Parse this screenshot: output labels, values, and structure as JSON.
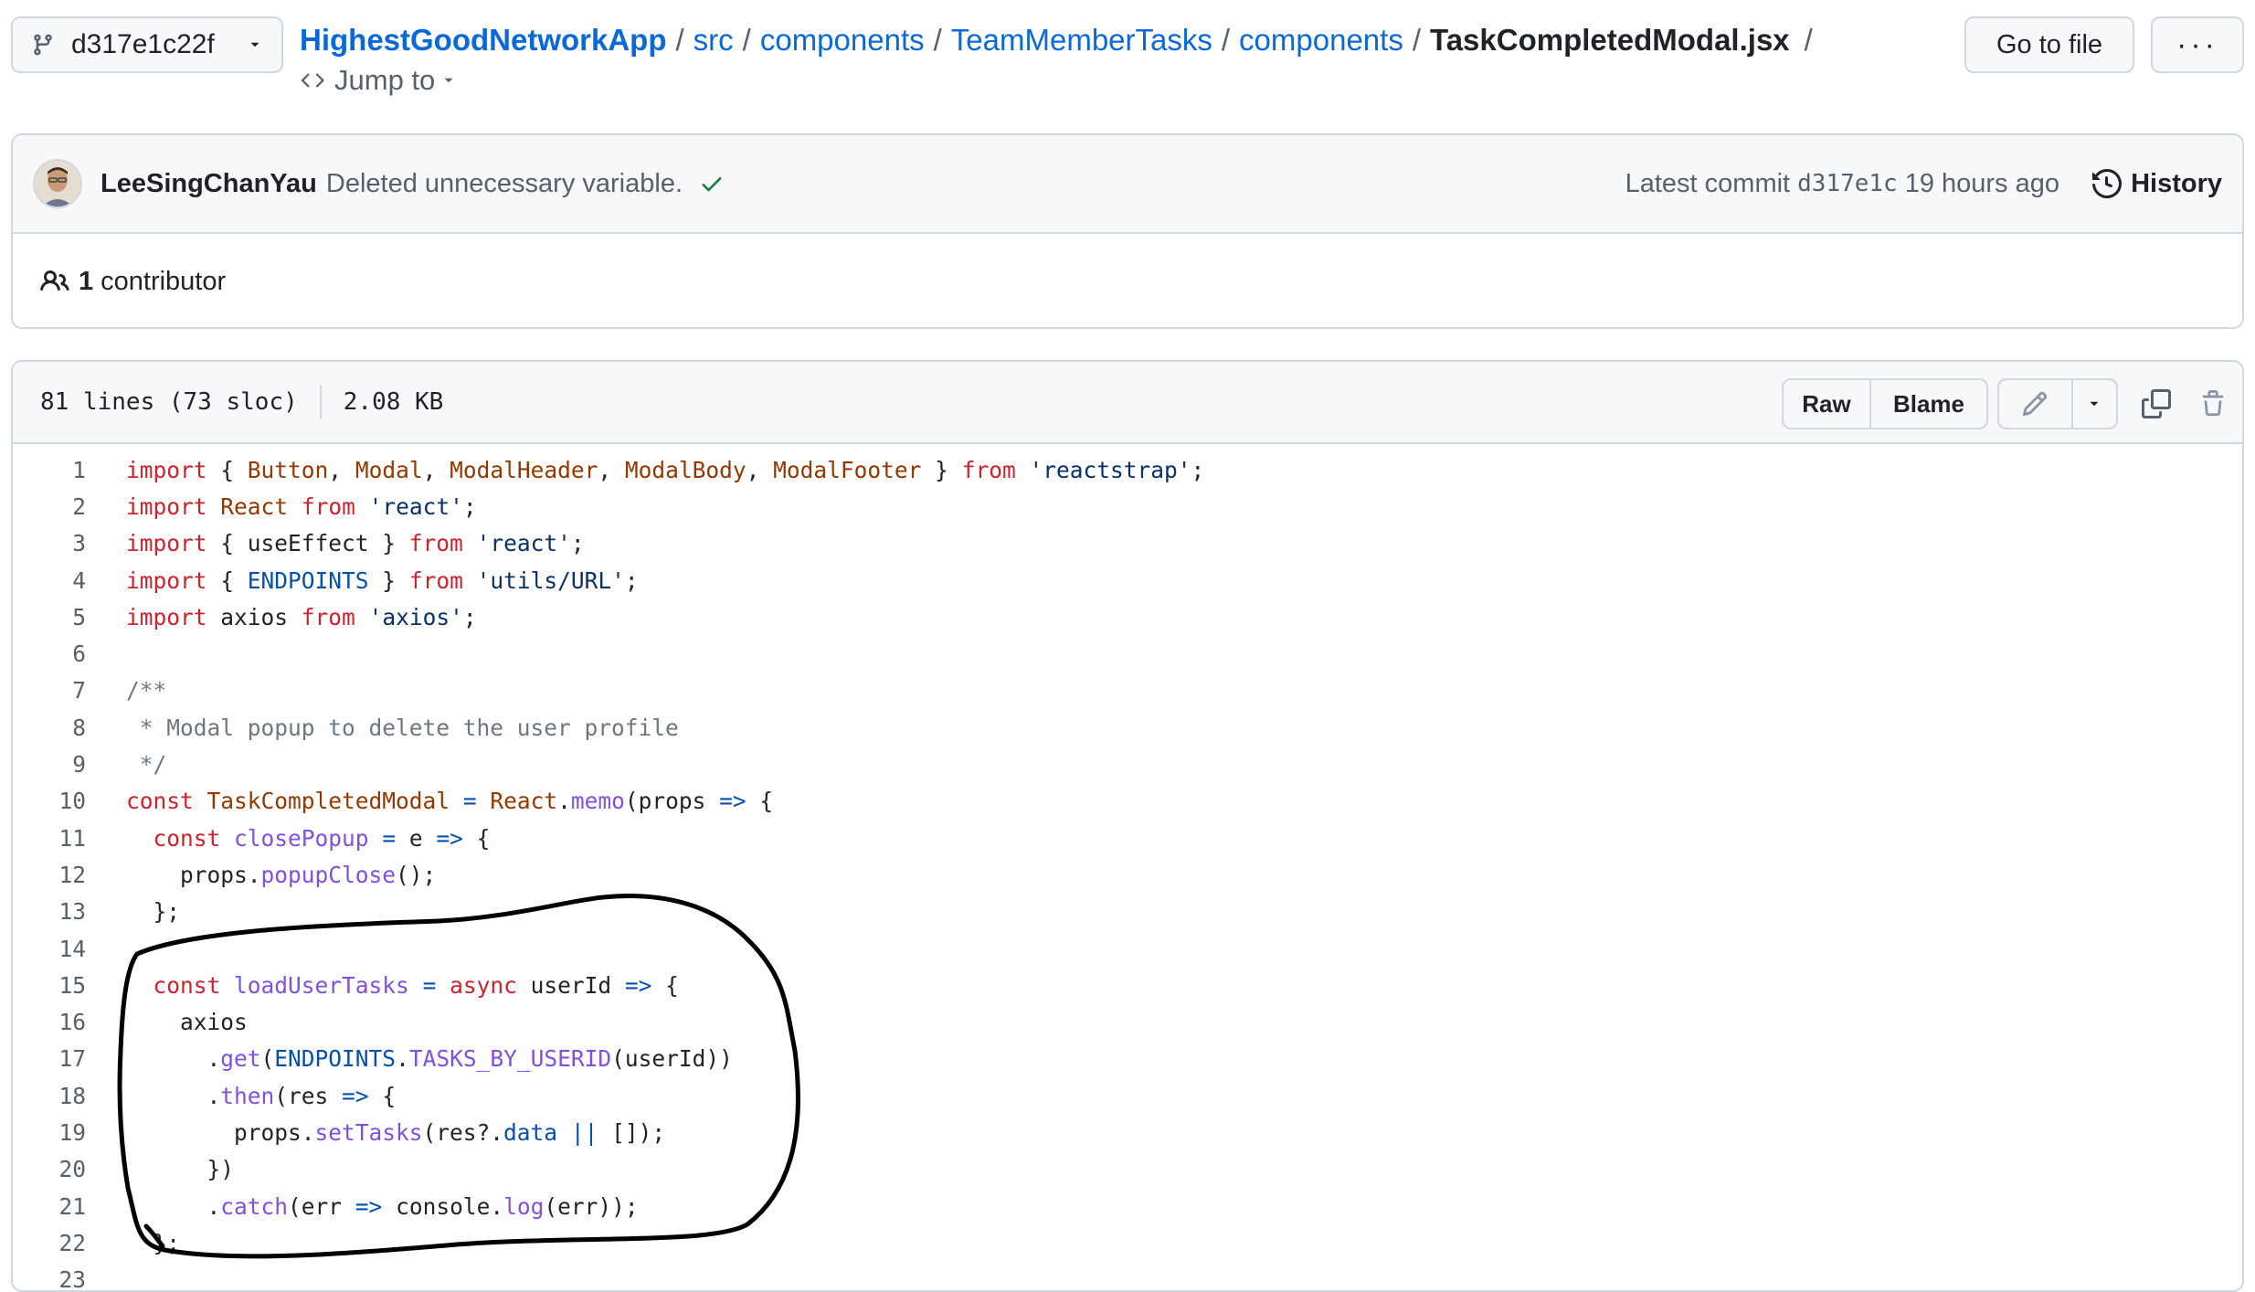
{
  "branch": {
    "name": "d317e1c22f"
  },
  "breadcrumb": {
    "repo": "HighestGoodNetworkApp",
    "parts": [
      "src",
      "components",
      "TeamMemberTasks",
      "components"
    ],
    "file": "TaskCompletedModal.jsx",
    "trailing_sep": "/",
    "jump_to": "Jump to"
  },
  "actions": {
    "go_to_file": "Go to file",
    "more": "···"
  },
  "commit": {
    "author": "LeeSingChanYau",
    "message": "Deleted unnecessary variable.",
    "latest_label": "Latest commit",
    "sha": "d317e1c",
    "time": "19 hours ago",
    "history_label": "History"
  },
  "contributors": {
    "count": "1",
    "label": "contributor"
  },
  "file": {
    "lines_info": "81 lines (73 sloc)",
    "size": "2.08 KB",
    "raw_label": "Raw",
    "blame_label": "Blame"
  },
  "code_lines": [
    [
      [
        "k",
        "import"
      ],
      [
        "p",
        " { "
      ],
      [
        "e",
        "Button"
      ],
      [
        "p",
        ", "
      ],
      [
        "e",
        "Modal"
      ],
      [
        "p",
        ", "
      ],
      [
        "e",
        "ModalHeader"
      ],
      [
        "p",
        ", "
      ],
      [
        "e",
        "ModalBody"
      ],
      [
        "p",
        ", "
      ],
      [
        "e",
        "ModalFooter"
      ],
      [
        "p",
        " } "
      ],
      [
        "k",
        "from"
      ],
      [
        "p",
        " "
      ],
      [
        "s",
        "'reactstrap'"
      ],
      [
        "p",
        ";"
      ]
    ],
    [
      [
        "k",
        "import"
      ],
      [
        "p",
        " "
      ],
      [
        "e",
        "React"
      ],
      [
        "p",
        " "
      ],
      [
        "k",
        "from"
      ],
      [
        "p",
        " "
      ],
      [
        "s",
        "'react'"
      ],
      [
        "p",
        ";"
      ]
    ],
    [
      [
        "k",
        "import"
      ],
      [
        "p",
        " { useEffect } "
      ],
      [
        "k",
        "from"
      ],
      [
        "p",
        " "
      ],
      [
        "s",
        "'react'"
      ],
      [
        "p",
        ";"
      ]
    ],
    [
      [
        "k",
        "import"
      ],
      [
        "p",
        " { "
      ],
      [
        "o",
        "ENDPOINTS"
      ],
      [
        "p",
        " } "
      ],
      [
        "k",
        "from"
      ],
      [
        "p",
        " "
      ],
      [
        "s",
        "'utils/URL'"
      ],
      [
        "p",
        ";"
      ]
    ],
    [
      [
        "k",
        "import"
      ],
      [
        "p",
        " axios "
      ],
      [
        "k",
        "from"
      ],
      [
        "p",
        " "
      ],
      [
        "s",
        "'axios'"
      ],
      [
        "p",
        ";"
      ]
    ],
    [],
    [
      [
        "c",
        "/**"
      ]
    ],
    [
      [
        "c",
        " * Modal popup to delete the user profile"
      ]
    ],
    [
      [
        "c",
        " */"
      ]
    ],
    [
      [
        "k",
        "const"
      ],
      [
        "p",
        " "
      ],
      [
        "e",
        "TaskCompletedModal"
      ],
      [
        "p",
        " "
      ],
      [
        "o",
        "="
      ],
      [
        "p",
        " "
      ],
      [
        "e",
        "React"
      ],
      [
        "p",
        "."
      ],
      [
        "f",
        "memo"
      ],
      [
        "p",
        "(props "
      ],
      [
        "o",
        "=>"
      ],
      [
        "p",
        " {"
      ]
    ],
    [
      [
        "p",
        "  "
      ],
      [
        "k",
        "const"
      ],
      [
        "p",
        " "
      ],
      [
        "f",
        "closePopup"
      ],
      [
        "p",
        " "
      ],
      [
        "o",
        "="
      ],
      [
        "p",
        " e "
      ],
      [
        "o",
        "=>"
      ],
      [
        "p",
        " {"
      ]
    ],
    [
      [
        "p",
        "    props."
      ],
      [
        "f",
        "popupClose"
      ],
      [
        "p",
        "();"
      ]
    ],
    [
      [
        "p",
        "  };"
      ]
    ],
    [],
    [
      [
        "p",
        "  "
      ],
      [
        "k",
        "const"
      ],
      [
        "p",
        " "
      ],
      [
        "f",
        "loadUserTasks"
      ],
      [
        "p",
        " "
      ],
      [
        "o",
        "="
      ],
      [
        "p",
        " "
      ],
      [
        "k",
        "async"
      ],
      [
        "p",
        " userId "
      ],
      [
        "o",
        "=>"
      ],
      [
        "p",
        " {"
      ]
    ],
    [
      [
        "p",
        "    axios"
      ]
    ],
    [
      [
        "p",
        "      ."
      ],
      [
        "f",
        "get"
      ],
      [
        "p",
        "("
      ],
      [
        "o",
        "ENDPOINTS"
      ],
      [
        "p",
        "."
      ],
      [
        "f",
        "TASKS_BY_USERID"
      ],
      [
        "p",
        "(userId))"
      ]
    ],
    [
      [
        "p",
        "      ."
      ],
      [
        "f",
        "then"
      ],
      [
        "p",
        "(res "
      ],
      [
        "o",
        "=>"
      ],
      [
        "p",
        " {"
      ]
    ],
    [
      [
        "p",
        "        props."
      ],
      [
        "f",
        "setTasks"
      ],
      [
        "p",
        "(res?."
      ],
      [
        "o",
        "data"
      ],
      [
        "p",
        " "
      ],
      [
        "o",
        "||"
      ],
      [
        "p",
        " []);"
      ]
    ],
    [
      [
        "p",
        "      })"
      ]
    ],
    [
      [
        "p",
        "      ."
      ],
      [
        "f",
        "catch"
      ],
      [
        "p",
        "(err "
      ],
      [
        "o",
        "=>"
      ],
      [
        "p",
        " console."
      ],
      [
        "f",
        "log"
      ],
      [
        "p",
        "(err));"
      ]
    ],
    [
      [
        "p",
        "  };"
      ]
    ],
    []
  ],
  "colors": {
    "link": "#0969da",
    "keyword": "#cf222e",
    "string": "#0a3069",
    "entity": "#953800",
    "function": "#8250df",
    "comment": "#6e7781",
    "constant": "#0550ae",
    "success": "#1a7f37"
  }
}
